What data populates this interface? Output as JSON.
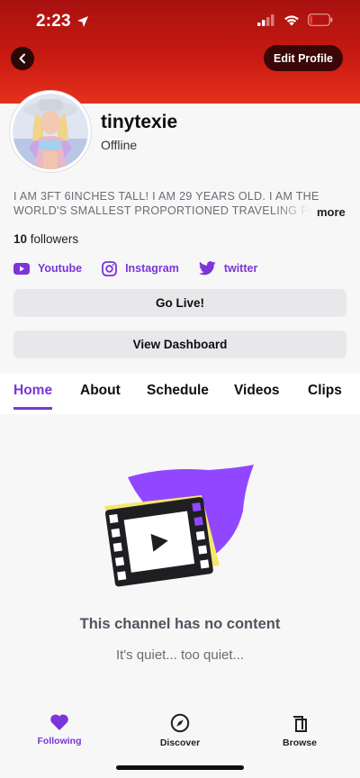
{
  "status_bar": {
    "time": "2:23"
  },
  "header": {
    "edit_label": "Edit Profile"
  },
  "profile": {
    "username": "tinytexie",
    "presence": "Offline",
    "bio_line1": "I AM 3FT 6INCHES TALL! I AM 29 YEARS OLD. I AM THE",
    "bio_line2": "WORLD'S SMALLEST PROPORTIONED TRAVELING FEMALE",
    "more_label": "more",
    "followers_count": "10",
    "followers_label": "followers"
  },
  "socials": [
    {
      "label": "Youtube",
      "icon": "youtube-icon"
    },
    {
      "label": "Instagram",
      "icon": "instagram-icon"
    },
    {
      "label": "twitter",
      "icon": "twitter-icon"
    }
  ],
  "actions": {
    "go_live": "Go Live!",
    "view_dashboard": "View Dashboard"
  },
  "tabs": [
    {
      "label": "Home",
      "active": true
    },
    {
      "label": "About"
    },
    {
      "label": "Schedule"
    },
    {
      "label": "Videos"
    },
    {
      "label": "Clips"
    }
  ],
  "empty_state": {
    "title": "This channel has no content",
    "subtitle": "It's quiet... too quiet..."
  },
  "nav": [
    {
      "label": "Following",
      "icon": "heart-icon",
      "active": true
    },
    {
      "label": "Discover",
      "icon": "compass-icon"
    },
    {
      "label": "Browse",
      "icon": "browse-icon"
    }
  ],
  "colors": {
    "accent": "#7b35d9",
    "header_top": "#a8110f",
    "header_bottom": "#e6301c"
  }
}
